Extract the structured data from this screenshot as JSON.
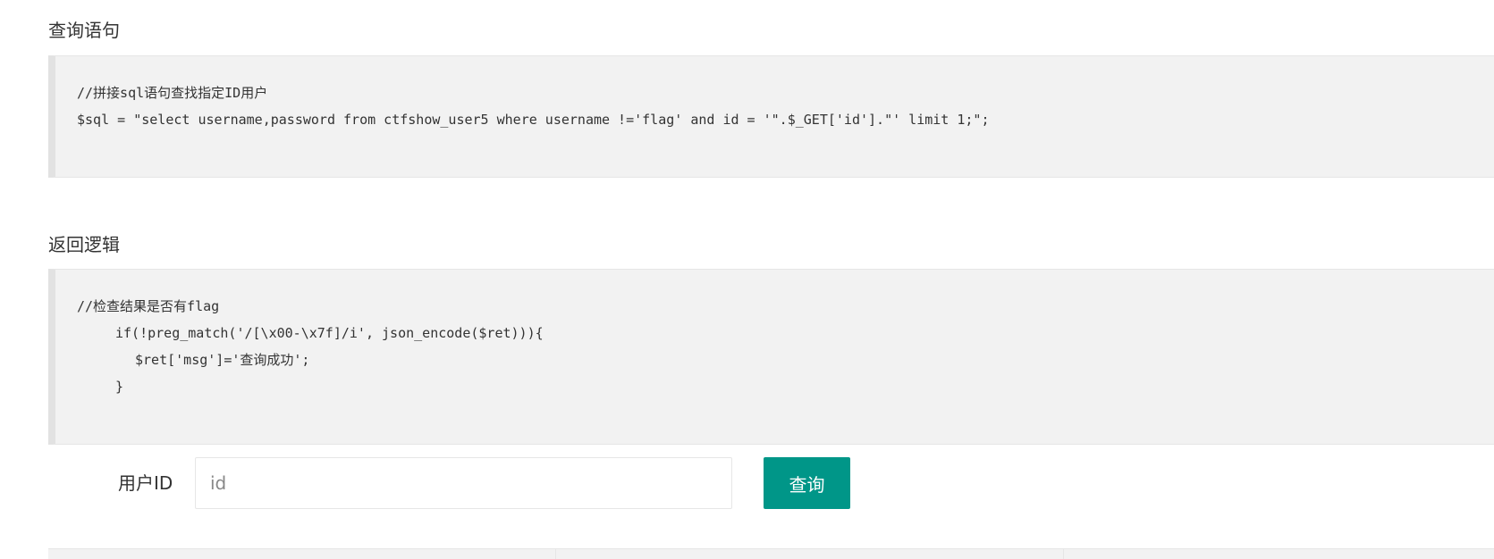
{
  "sections": {
    "query": {
      "title": "查询语句",
      "lines": [
        "//拼接sql语句查找指定ID用户",
        "$sql = \"select username,password from ctfshow_user5 where username !='flag' and id = '\".$_GET['id'].\"' limit 1;\";"
      ]
    },
    "return_logic": {
      "title": "返回逻辑",
      "lines": [
        "//检查结果是否有flag",
        "if(!preg_match('/[\\x00-\\x7f]/i', json_encode($ret))){",
        "$ret['msg']='查询成功';",
        "}"
      ]
    }
  },
  "form": {
    "label": "用户ID",
    "input_placeholder": "id",
    "input_value": "",
    "button_label": "查询"
  },
  "colors": {
    "button": "#009688",
    "code_background": "#f2f2f2"
  }
}
